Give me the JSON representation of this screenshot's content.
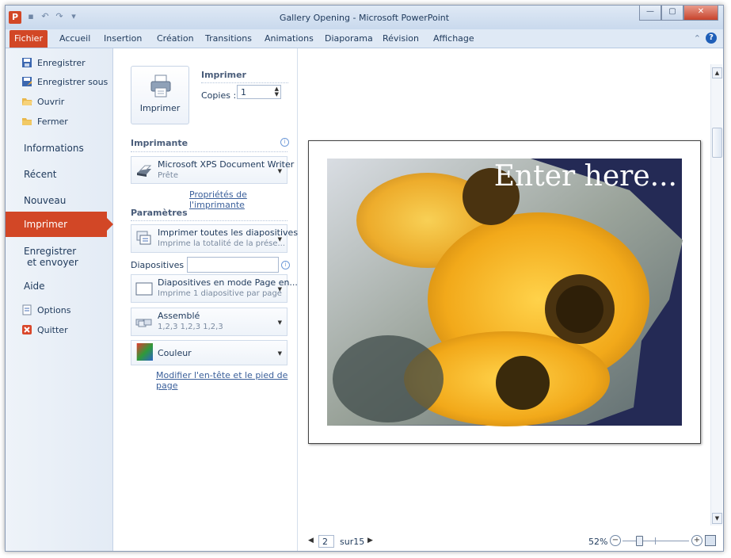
{
  "window": {
    "title": "Gallery Opening - Microsoft PowerPoint",
    "app_icon_letter": "P",
    "controls": {
      "minimize": "—",
      "maximize": "▢",
      "close": "✕"
    }
  },
  "ribbon_tabs": [
    "Fichier",
    "Accueil",
    "Insertion",
    "Création",
    "Transitions",
    "Animations",
    "Diaporama",
    "Révision",
    "Affichage"
  ],
  "backstage": {
    "small_items": [
      {
        "label": "Enregistrer",
        "icon": "save-icon"
      },
      {
        "label": "Enregistrer sous",
        "icon": "save-as-icon"
      },
      {
        "label": "Ouvrir",
        "icon": "open-folder-icon"
      },
      {
        "label": "Fermer",
        "icon": "close-folder-icon"
      }
    ],
    "big_items": [
      "Informations",
      "Récent",
      "Nouveau"
    ],
    "active_item": "Imprimer",
    "send_line1": "Enregistrer",
    "send_line2": "et envoyer",
    "help": "Aide",
    "options": "Options",
    "quit": "Quitter"
  },
  "print": {
    "button_label": "Imprimer",
    "section_title": "Imprimer",
    "copies_label": "Copies :",
    "copies_value": "1",
    "printer_title": "Imprimante",
    "printer_name": "Microsoft XPS Document Writer",
    "printer_status": "Prête",
    "printer_props_link": "Propriétés de l'imprimante",
    "settings_title": "Paramètres",
    "range_main": "Imprimer toutes les diapositives",
    "range_sub": "Imprime la totalité de la prése...",
    "slides_label": "Diapositives :",
    "slides_value": "",
    "layout_main": "Diapositives en mode Page en...",
    "layout_sub": "Imprime 1 diapositive par page",
    "collate_main": "Assemblé",
    "collate_sub": "1,2,3   1,2,3   1,2,3",
    "color_main": "Couleur",
    "header_footer_link": "Modifier l'en-tête et le pied de page"
  },
  "preview": {
    "slide_text": "Enter here...",
    "current_page": "2",
    "page_total": "sur15",
    "zoom": "52%",
    "zoom_level_percent": 52
  },
  "colors": {
    "file_tab": "#d24726",
    "slide_background": "#242a55",
    "title_bar": "#dfe9f5"
  }
}
